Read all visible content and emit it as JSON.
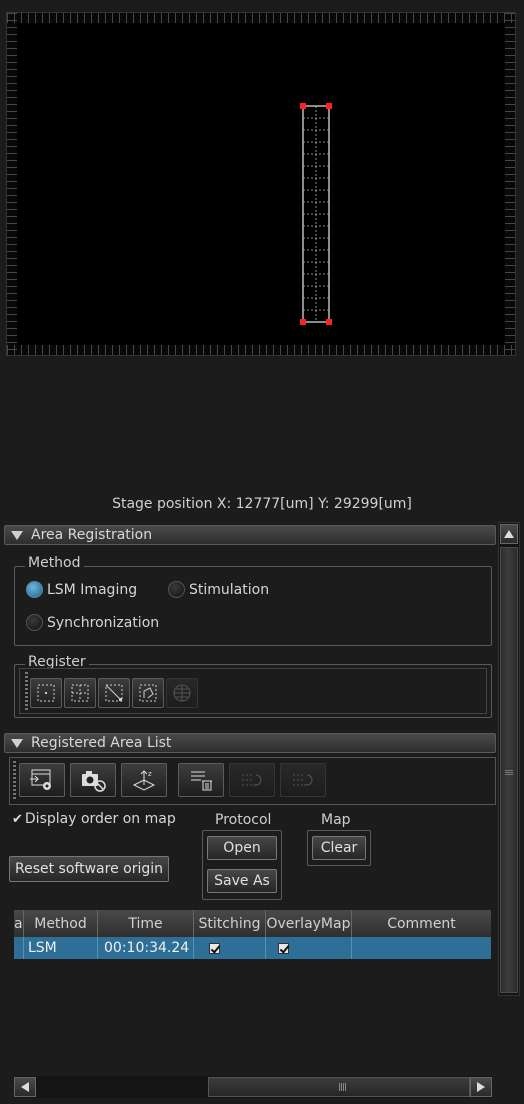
{
  "stage_position": "Stage position  X: 12777[um] Y: 29299[um]",
  "area_registration": {
    "header": "Area Registration",
    "method_title": "Method",
    "methods": {
      "lsm": "LSM Imaging",
      "stimulation": "Stimulation",
      "synchronization": "Synchronization"
    },
    "selected_method": "LSM Imaging",
    "register_title": "Register"
  },
  "registered_area_list": {
    "header": "Registered Area List",
    "display_order_label": "Display order on map",
    "display_order_checked": true,
    "protocol_title": "Protocol",
    "open_label": "Open",
    "save_as_label": "Save As",
    "map_title": "Map",
    "clear_label": "Clear",
    "reset_label": "Reset software origin"
  },
  "table": {
    "columns": [
      "a",
      "Method",
      "Time",
      "Stitching",
      "OverlayMap",
      "Comment"
    ],
    "rows": [
      {
        "method": "LSM",
        "time": "00:10:34.24",
        "stitching": true,
        "overlay_map": true,
        "comment": ""
      }
    ]
  },
  "colors": {
    "selected_row": "#2d6f96",
    "radio_selected": "#4b8db4",
    "map_marker": "#ff2020"
  },
  "icons": {
    "register": [
      "single-area-icon",
      "tile-area-icon",
      "diagonal-area-icon",
      "polygon-area-icon",
      "multi-area-icon"
    ],
    "list": [
      "load-settings-icon",
      "camera-settings-icon",
      "z-stack-icon",
      "delete-list-icon",
      "list-forward-icon",
      "list-back-icon"
    ]
  }
}
